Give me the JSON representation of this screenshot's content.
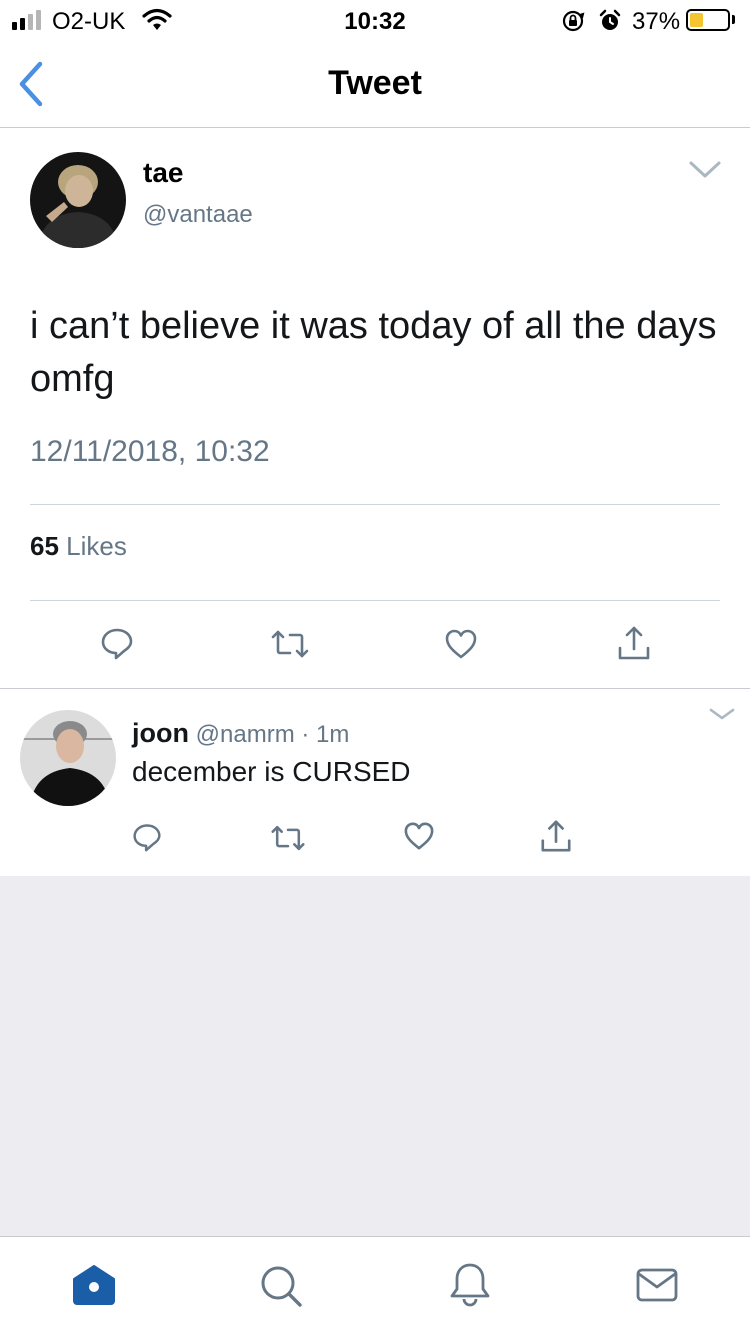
{
  "status_bar": {
    "carrier": "O2-UK",
    "time": "10:32",
    "battery_percent": "37%",
    "battery_level": 0.37,
    "battery_color": "#f4c431",
    "icons": [
      "cellular-signal-icon",
      "wifi-icon",
      "rotation-lock-icon",
      "alarm-clock-icon",
      "battery-icon"
    ]
  },
  "nav": {
    "title": "Tweet",
    "back_icon": "chevron-left-icon",
    "accent_color": "#4a90e2"
  },
  "tweet": {
    "name": "tae",
    "handle": "@vantaae",
    "text": "i can’t believe it was today of all the days omfg",
    "timestamp": "12/11/2018, 10:32",
    "likes_count": "65",
    "likes_label": "Likes",
    "actions": [
      "reply-icon",
      "retweet-icon",
      "like-icon",
      "share-icon"
    ]
  },
  "reply": {
    "name": "joon",
    "handle": "@namrm",
    "separator": "·",
    "age": "1m",
    "text": "december is CURSED",
    "actions": [
      "reply-icon",
      "retweet-icon",
      "like-icon",
      "share-icon"
    ]
  },
  "tab_bar": {
    "tabs": [
      "home-icon",
      "search-icon",
      "notifications-icon",
      "messages-icon"
    ],
    "active_color": "#1b5ea8"
  }
}
